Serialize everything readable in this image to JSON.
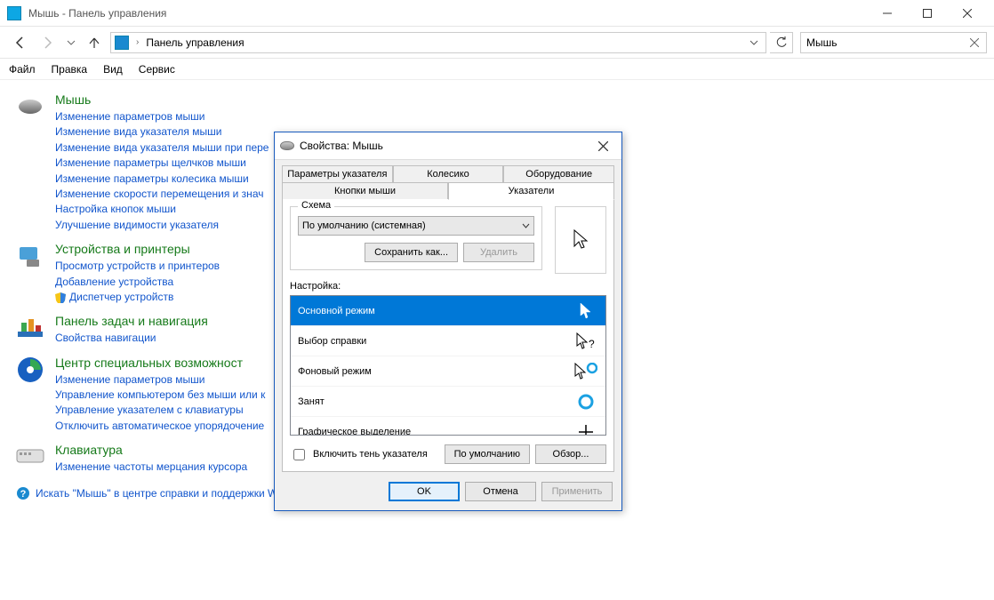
{
  "window": {
    "title": "Мышь - Панель управления"
  },
  "nav": {
    "path": "Панель управления"
  },
  "search": {
    "value": "Мышь"
  },
  "menu": {
    "file": "Файл",
    "edit": "Правка",
    "view": "Вид",
    "service": "Сервис"
  },
  "sections": [
    {
      "title": "Мышь",
      "links": [
        "Изменение параметров мыши",
        "Изменение вида указателя мыши",
        "Изменение вида указателя мыши при пере",
        "Изменение параметры щелчков мыши",
        "Изменение параметры колесика мыши",
        "Изменение скорости перемещения и знач",
        "Настройка кнопок мыши",
        "Улучшение видимости указателя"
      ]
    },
    {
      "title": "Устройства и принтеры",
      "links": [
        "Просмотр устройств и принтеров",
        "Добавление устройства",
        "Диспетчер устройств"
      ]
    },
    {
      "title": "Панель задач и навигация",
      "links": [
        "Свойства навигации"
      ]
    },
    {
      "title": "Центр специальных возможност",
      "links": [
        "Изменение параметров мыши",
        "Управление компьютером без мыши или к",
        "Управление указателем с клавиатуры",
        "Отключить автоматическое упорядочение"
      ]
    },
    {
      "title": "Клавиатура",
      "links": [
        "Изменение частоты мерцания курсора"
      ]
    }
  ],
  "help": {
    "text": "Искать \"Мышь\" в центре справки и поддержки W"
  },
  "dialog": {
    "title": "Свойства: Мышь",
    "tabs": {
      "row1": [
        "Параметры указателя",
        "Колесико",
        "Оборудование"
      ],
      "row2": [
        "Кнопки мыши",
        "Указатели"
      ]
    },
    "scheme": {
      "legend": "Схема",
      "value": "По умолчанию (системная)",
      "save_as": "Сохранить как...",
      "delete": "Удалить"
    },
    "setting_label": "Настройка:",
    "cursors": [
      {
        "name": "Основной режим"
      },
      {
        "name": "Выбор справки"
      },
      {
        "name": "Фоновый режим"
      },
      {
        "name": "Занят"
      },
      {
        "name": "Графическое выделение"
      }
    ],
    "shadow_checkbox": "Включить тень указателя",
    "defaults_btn": "По умолчанию",
    "browse_btn": "Обзор...",
    "footer": {
      "ok": "OK",
      "cancel": "Отмена",
      "apply": "Применить"
    }
  }
}
